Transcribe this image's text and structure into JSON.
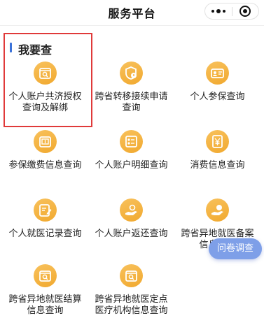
{
  "header": {
    "title": "服务平台"
  },
  "section": {
    "title": "我要查"
  },
  "items": [
    {
      "label": "个人账户共济授权查询及解绑",
      "icon": "account-search-icon"
    },
    {
      "label": "跨省转移接续申请查询",
      "icon": "shield-transfer-icon"
    },
    {
      "label": "个人参保查询",
      "icon": "person-card-icon"
    },
    {
      "label": "参保缴费信息查询",
      "icon": "payment-icon"
    },
    {
      "label": "个人账户明细查询",
      "icon": "detail-list-icon"
    },
    {
      "label": "消费信息查询",
      "icon": "yuan-coin-icon"
    },
    {
      "label": "个人就医记录查询",
      "icon": "edit-record-icon"
    },
    {
      "label": "个人账户返还查询",
      "icon": "hand-return-icon"
    },
    {
      "label": "跨省异地就医备案信息查询",
      "icon": "hand-coin-icon"
    },
    {
      "label": "跨省异地就医结算信息查询",
      "icon": "folder-search-icon"
    },
    {
      "label": "跨省异地就医定点医疗机构信息查询",
      "icon": "folder-hospital-icon"
    }
  ],
  "survey_button": {
    "label": "问卷调查"
  },
  "colors": {
    "icon_bg": "#f4b142",
    "highlight": "#e03a3a",
    "accent": "#3b72d9",
    "survey_bg": "#7e9fe8"
  }
}
